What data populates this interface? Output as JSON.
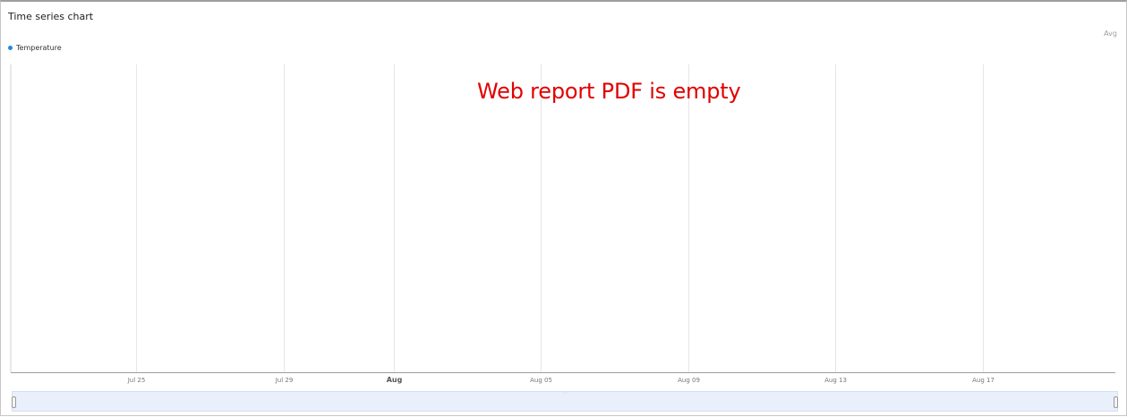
{
  "widget": {
    "title": "Time series chart",
    "aggregation_label": "Avg",
    "annotation": "Web report PDF is empty",
    "annotation_color": "#e10000"
  },
  "chart_data": {
    "type": "line",
    "legend": [
      {
        "name": "Temperature",
        "color": "#1e88e5"
      }
    ],
    "x_axis_type": "date",
    "x_ticks": [
      {
        "date": "2000-07-25",
        "label": "Jul 25",
        "major": false
      },
      {
        "date": "2000-07-29",
        "label": "Jul 29",
        "major": false
      },
      {
        "date": "2000-08-01",
        "label": "Aug",
        "major": true
      },
      {
        "date": "2000-08-05",
        "label": "Aug 05",
        "major": false
      },
      {
        "date": "2000-08-09",
        "label": "Aug 09",
        "major": false
      },
      {
        "date": "2000-08-13",
        "label": "Aug 13",
        "major": false
      },
      {
        "date": "2000-08-17",
        "label": "Aug 17",
        "major": false
      }
    ],
    "series": [
      {
        "name": "Temperature",
        "values": []
      }
    ],
    "y_axis_labels": false,
    "grid": "vertical",
    "legend_position": "top-left"
  },
  "navigator": {
    "range": "full"
  }
}
